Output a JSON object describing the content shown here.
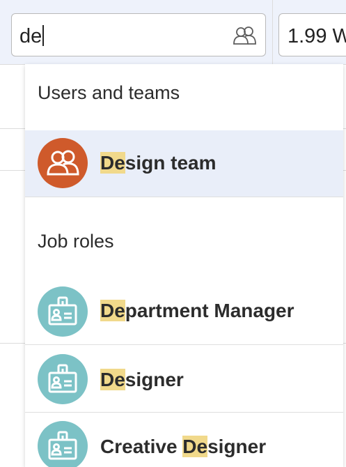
{
  "search": {
    "value": "de"
  },
  "rate_field": {
    "value": "1.99 W"
  },
  "dropdown": {
    "sections": [
      {
        "heading": "Users and teams",
        "items": [
          {
            "highlight": "De",
            "rest": "sign team",
            "icon": "team-icon",
            "avatar_color": "#cf5a2b",
            "selected": true
          }
        ]
      },
      {
        "heading": "Job roles",
        "items": [
          {
            "prefix": "",
            "highlight": "De",
            "rest": "partment Manager",
            "icon": "id-badge-icon",
            "avatar_color": "#7cc2c6"
          },
          {
            "prefix": "",
            "highlight": "De",
            "rest": "signer",
            "icon": "id-badge-icon",
            "avatar_color": "#7cc2c6"
          },
          {
            "prefix": "Creative ",
            "highlight": "De",
            "rest": "signer",
            "icon": "id-badge-icon",
            "avatar_color": "#7cc2c6"
          }
        ]
      }
    ]
  },
  "colors": {
    "selected_row": "#e9eef9",
    "match_highlight": "#f1d98b",
    "team_avatar": "#cf5a2b",
    "role_avatar": "#7cc2c6"
  }
}
